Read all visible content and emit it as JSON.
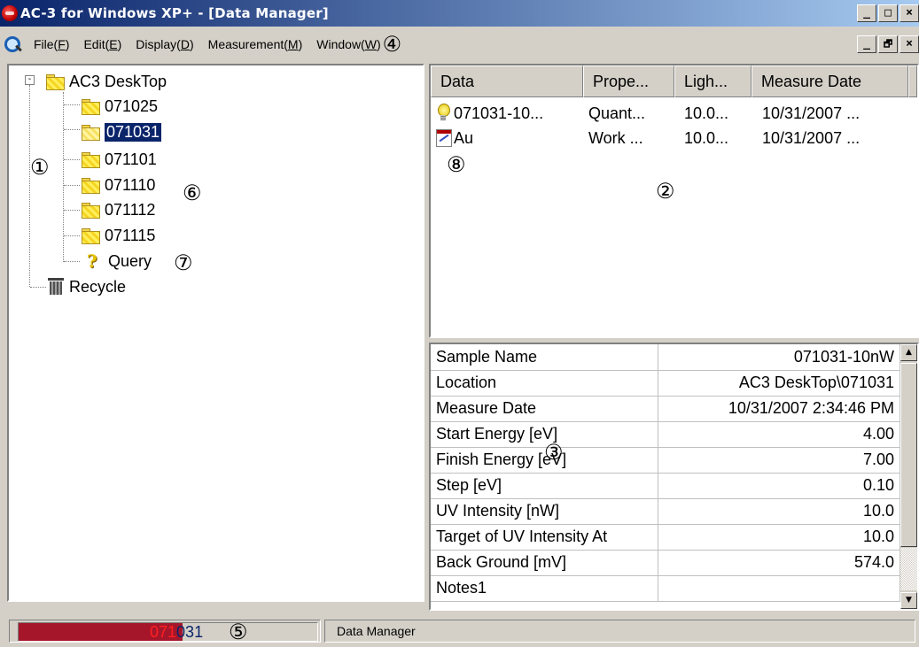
{
  "titlebar": {
    "title": "AC-3 for Windows XP+ - [Data Manager]",
    "buttons": [
      "_",
      "□",
      "×"
    ]
  },
  "menubar": {
    "items": [
      {
        "label": "File(",
        "key": "F",
        "suffix": ")"
      },
      {
        "label": "Edit(",
        "key": "E",
        "suffix": ")"
      },
      {
        "label": "Display(",
        "key": "D",
        "suffix": ")"
      },
      {
        "label": "Measurement(",
        "key": "M",
        "suffix": ")"
      },
      {
        "label": "Window(",
        "key": "W",
        "suffix": ")"
      }
    ],
    "mdi_buttons": [
      "_",
      "🗗",
      "×"
    ]
  },
  "annotations": {
    "n1": "①",
    "n2": "②",
    "n3": "③",
    "n4": "④",
    "n5": "⑤",
    "n6": "⑥",
    "n7": "⑦",
    "n8": "⑧"
  },
  "tree": {
    "root": {
      "label": "AC3 DeskTop",
      "expander": "-"
    },
    "folders": [
      "071025",
      "071031",
      "071101",
      "071110",
      "071112",
      "071115"
    ],
    "selected": "071031",
    "query": {
      "label": "Query",
      "icon": "?"
    },
    "recycle": {
      "label": "Recycle"
    }
  },
  "list": {
    "columns": [
      "Data",
      "Prope...",
      "Ligh...",
      "Measure Date"
    ],
    "rows": [
      {
        "icon": "bulb-icon",
        "data": "071031-10...",
        "property": "Quant...",
        "light": "10.0...",
        "date": "10/31/2007 ..."
      },
      {
        "icon": "chart-icon",
        "data": "Au",
        "property": "Work ...",
        "light": "10.0...",
        "date": "10/31/2007 ..."
      }
    ]
  },
  "properties": [
    {
      "key": "Sample Name",
      "value": "071031-10nW"
    },
    {
      "key": "Location",
      "value": "AC3 DeskTop\\071031"
    },
    {
      "key": "Measure Date",
      "value": "10/31/2007 2:34:46 PM"
    },
    {
      "key": "Start Energy [eV]",
      "value": "4.00"
    },
    {
      "key": "Finish Energy [eV]",
      "value": "7.00"
    },
    {
      "key": "Step [eV]",
      "value": "0.10"
    },
    {
      "key": "UV Intensity [nW]",
      "value": "10.0"
    },
    {
      "key": "Target of UV Intensity At",
      "value": "10.0"
    },
    {
      "key": "Back Ground [mV]",
      "value": "574.0"
    },
    {
      "key": "Notes1",
      "value": ""
    }
  ],
  "statusbar": {
    "progress_red": "071",
    "progress_blue": "031",
    "progress_fraction": 0.55,
    "text": "Data Manager"
  },
  "colors": {
    "title_start": "#0a246a",
    "title_end": "#a6caf0",
    "selection": "#0a246a",
    "progress_fill": "#a6162a"
  }
}
